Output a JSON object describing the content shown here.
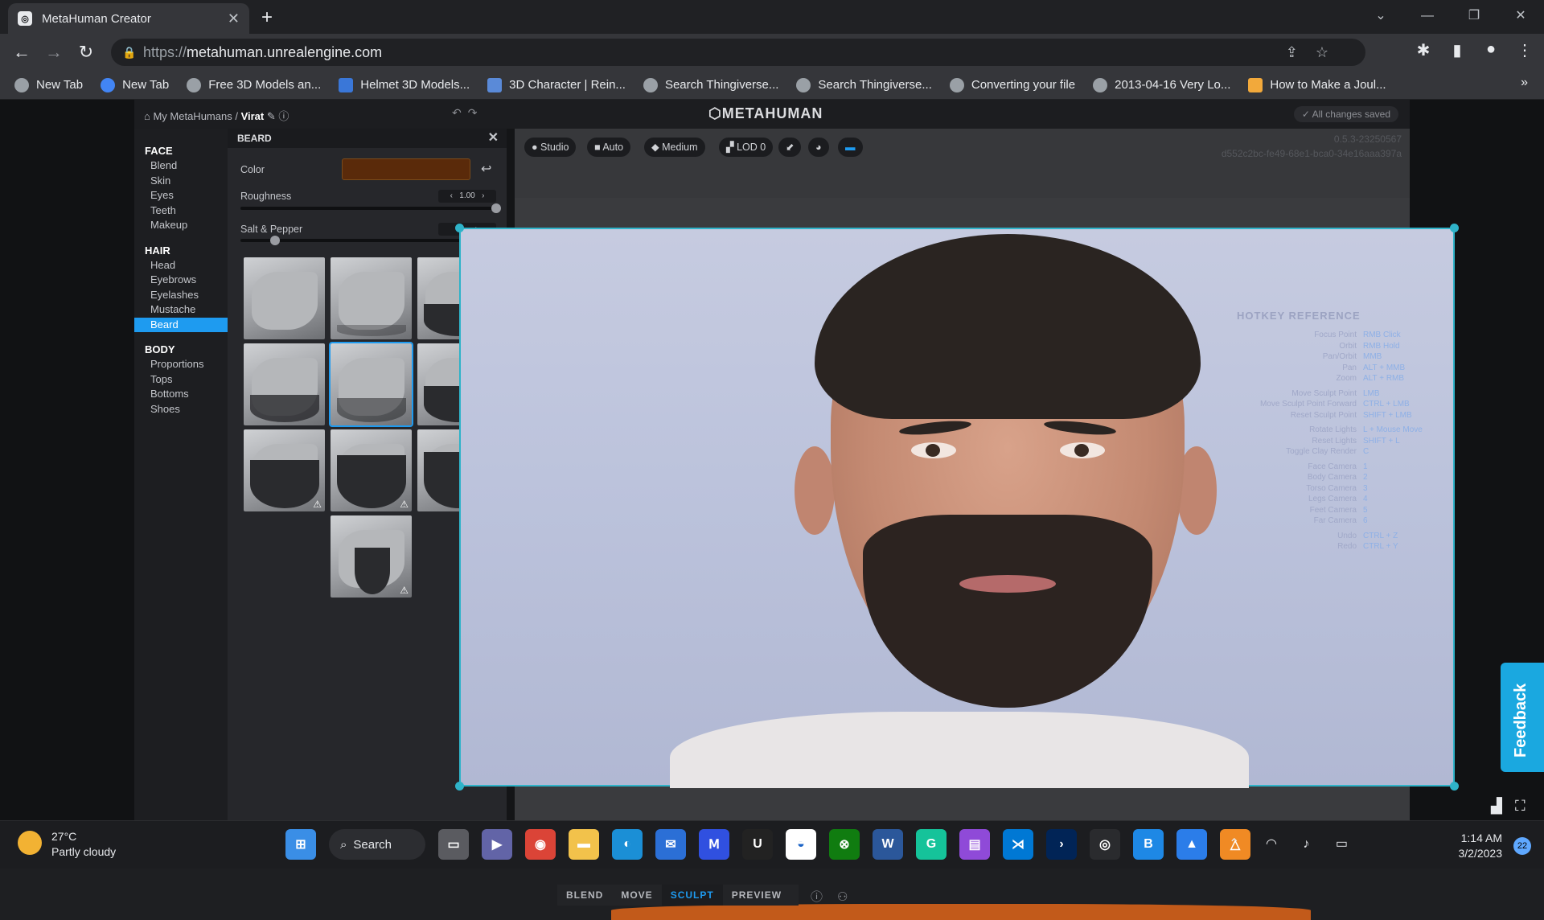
{
  "browser": {
    "tab_title": "MetaHuman Creator",
    "url_scheme": "https://",
    "url_host": "metahuman.unrealengine.com",
    "bookmarks": [
      {
        "label": "New Tab"
      },
      {
        "label": "New Tab"
      },
      {
        "label": "Free 3D Models an..."
      },
      {
        "label": "Helmet 3D Models..."
      },
      {
        "label": "3D Character | Rein..."
      },
      {
        "label": "Search Thingiverse..."
      },
      {
        "label": "Search Thingiverse..."
      },
      {
        "label": "Converting your file"
      },
      {
        "label": "2013-04-16 Very Lo..."
      },
      {
        "label": "How to Make a Joul..."
      }
    ]
  },
  "app": {
    "breadcrumb_root": "My MetaHumans /",
    "breadcrumb_current": "Virat",
    "logo": "METAHUMAN",
    "save_status": "All changes saved",
    "version": "0.5.3-23250567",
    "session_id": "d552c2bc-fe49-68e1-bca0-34e16aaa397a"
  },
  "nav": {
    "sections": [
      {
        "title": "FACE",
        "items": [
          "Blend",
          "Skin",
          "Eyes",
          "Teeth",
          "Makeup"
        ]
      },
      {
        "title": "HAIR",
        "items": [
          "Head",
          "Eyebrows",
          "Eyelashes",
          "Mustache",
          "Beard"
        ]
      },
      {
        "title": "BODY",
        "items": [
          "Proportions",
          "Tops",
          "Bottoms",
          "Shoes"
        ]
      }
    ],
    "active_item": "Beard"
  },
  "beard_panel": {
    "title": "BEARD",
    "color_label": "Color",
    "color_value": "#5a2a0a",
    "roughness_label": "Roughness",
    "roughness_value": "1.00",
    "roughness_level": 1.0,
    "salt_label": "Salt & Pepper",
    "salt_level": 0.12
  },
  "viewport_toolbar": {
    "chips": [
      "Studio",
      "Auto",
      "Medium",
      "LOD 0"
    ]
  },
  "hotkeys": {
    "title": "HOTKEY REFERENCE",
    "rows": [
      {
        "k": "Focus Point",
        "v": "RMB Click"
      },
      {
        "k": "Orbit",
        "v": "RMB Hold"
      },
      {
        "k": "Pan/Orbit",
        "v": "MMB"
      },
      {
        "k": "Pan",
        "v": "ALT + MMB"
      },
      {
        "k": "Zoom",
        "v": "ALT + RMB"
      },
      {
        "k": "Move Sculpt Point",
        "v": "LMB"
      },
      {
        "k": "Move Sculpt Point Forward",
        "v": "CTRL + LMB"
      },
      {
        "k": "Reset Sculpt Point",
        "v": "SHIFT + LMB"
      },
      {
        "k": "Rotate Lights",
        "v": "L + Mouse Move"
      },
      {
        "k": "Reset Lights",
        "v": "SHIFT + L"
      },
      {
        "k": "Toggle Clay Render",
        "v": "C"
      },
      {
        "k": "Face Camera",
        "v": "1"
      },
      {
        "k": "Body Camera",
        "v": "2"
      },
      {
        "k": "Torso Camera",
        "v": "3"
      },
      {
        "k": "Legs Camera",
        "v": "4"
      },
      {
        "k": "Feet Camera",
        "v": "5"
      },
      {
        "k": "Far Camera",
        "v": "6"
      },
      {
        "k": "Undo",
        "v": "CTRL + Z"
      },
      {
        "k": "Redo",
        "v": "CTRL + Y"
      }
    ]
  },
  "bottom_tabs": [
    "BLEND",
    "MOVE",
    "SCULPT",
    "PREVIEW"
  ],
  "active_bottom_tab": "SCULPT",
  "feedback_label": "Feedback",
  "taskbar": {
    "temperature": "27°C",
    "weather": "Partly cloudy",
    "search_label": "Search",
    "time": "1:14 AM",
    "date": "3/2/2023",
    "notifications": "22"
  }
}
